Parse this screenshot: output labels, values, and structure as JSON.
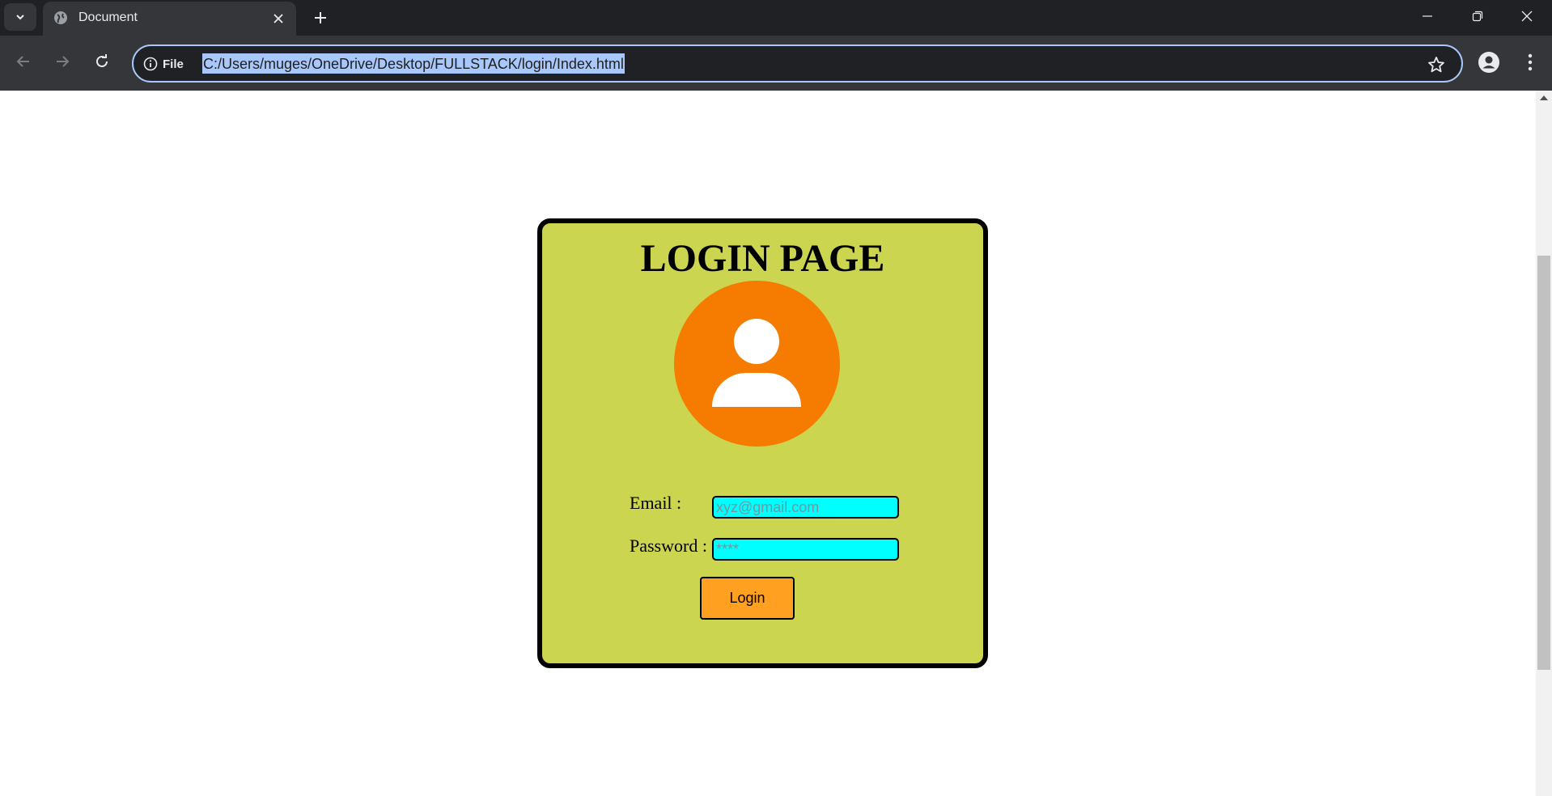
{
  "browser": {
    "tab_title": "Document",
    "site_info_label": "File",
    "url": "C:/Users/muges/OneDrive/Desktop/FULLSTACK/login/Index.html"
  },
  "page": {
    "title": "LOGIN PAGE",
    "email_label": "Email :",
    "email_placeholder": "xyz@gmail.com",
    "password_label": "Password :",
    "password_placeholder": "****",
    "login_button": "Login"
  },
  "colors": {
    "card_background": "#cbd550",
    "avatar_background": "#f57c00",
    "input_background": "#00ffff",
    "button_background": "#ffa021"
  },
  "icons": [
    "tab-list-icon",
    "globe-icon",
    "close-icon",
    "plus-icon",
    "minimize-icon",
    "restore-icon",
    "back-icon",
    "forward-icon",
    "reload-icon",
    "info-icon",
    "star-icon",
    "profile-icon",
    "more-icon",
    "user-avatar-icon"
  ]
}
